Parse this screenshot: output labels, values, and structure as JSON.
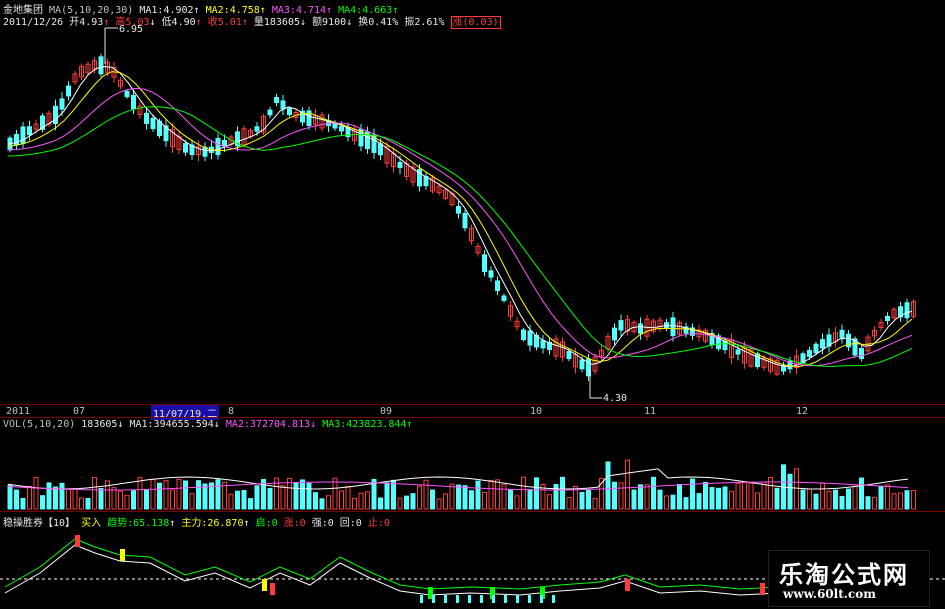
{
  "header": {
    "stock_name": "金地集团",
    "ma_label": "MA(5,10,20,30)",
    "ma1_label": "MA1:4.902",
    "ma1_arrow": "↑",
    "ma2_label": "MA2:4.758",
    "ma2_arrow": "↑",
    "ma3_label": "MA3:4.714",
    "ma3_arrow": "↑",
    "ma4_label": "MA4:4.663",
    "ma4_arrow": "↑"
  },
  "quote": {
    "date": "2011/12/26",
    "open": "开4.93",
    "open_arrow": "↑",
    "high": "高5.03",
    "high_arrow": "↓",
    "low": "低4.90",
    "low_arrow": "↑",
    "close": "收5.01",
    "close_arrow": "↑",
    "volume": "量183605",
    "volume_arrow": "↓",
    "amount": "额9100",
    "amount_arrow": "↓",
    "turnover": "换0.41%",
    "amplitude": "振2.61%",
    "change": "涨(0.03)"
  },
  "annotations": {
    "high_price": "6.95",
    "low_price": "4.30"
  },
  "time_axis": {
    "labels": [
      "2011",
      "07",
      "09",
      "10",
      "11",
      "12"
    ],
    "cursor": "11/07/19,二",
    "cursor_suffix": "8"
  },
  "vol_header": {
    "label": "VOL(5,10,20)",
    "value": "183605",
    "arrow": "↓",
    "ma1": "MA1:394655.594",
    "ma1_arrow": "↓",
    "ma2": "MA2:372704.813",
    "ma2_arrow": "↓",
    "ma3": "MA3:423823.844",
    "ma3_arrow": "↑"
  },
  "indicator_header": {
    "name": "稳操胜券",
    "param": "【10】",
    "buy": "买入",
    "trend": "趋势:65.138",
    "trend_arrow": "↑",
    "main_force": "主力:26.870",
    "main_force_arrow": "↑",
    "start": "启:0",
    "rise": "涨:0",
    "strong": "强:0",
    "back": "回:0",
    "stop": "止:0"
  },
  "watermark": {
    "name": "乐淘公式网",
    "url": "www.60lt.com"
  },
  "colors": {
    "up": "#ff3b3b",
    "down": "#54ffff",
    "ma1": "#ffffff",
    "ma2": "#ffff00",
    "ma3": "#ff55ff",
    "ma4": "#00ff00",
    "grid": "#7a0000"
  }
}
